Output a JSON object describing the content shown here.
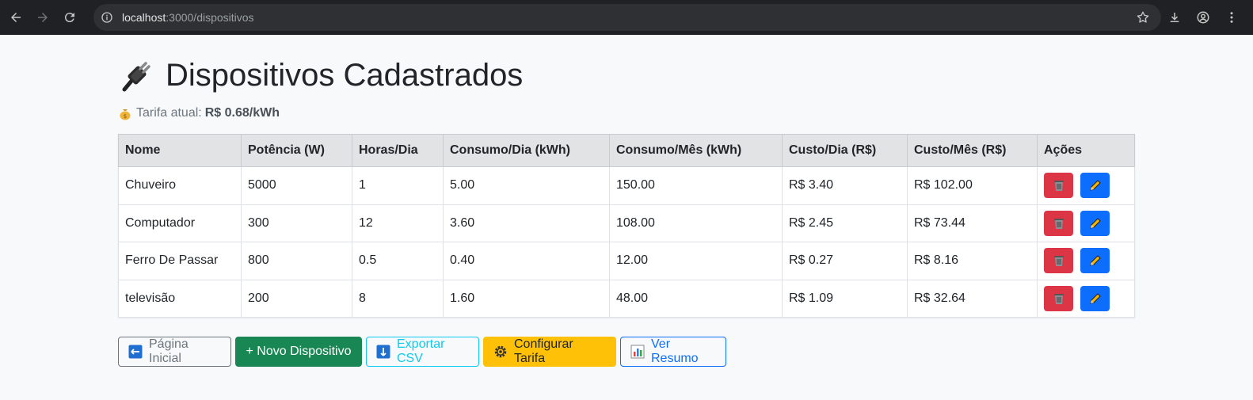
{
  "browser": {
    "url_host": "localhost",
    "url_path": ":3000/dispositivos"
  },
  "page": {
    "title": "Dispositivos Cadastrados",
    "tariff_label": "Tarifa atual:",
    "tariff_value": "R$ 0.68/kWh"
  },
  "table": {
    "headers": [
      "Nome",
      "Potência (W)",
      "Horas/Dia",
      "Consumo/Dia (kWh)",
      "Consumo/Mês (kWh)",
      "Custo/Dia (R$)",
      "Custo/Mês (R$)",
      "Ações"
    ],
    "rows": [
      [
        "Chuveiro",
        "5000",
        "1",
        "5.00",
        "150.00",
        "R$ 3.40",
        "R$ 102.00"
      ],
      [
        "Computador",
        "300",
        "12",
        "3.60",
        "108.00",
        "R$ 2.45",
        "R$ 73.44"
      ],
      [
        "Ferro De Passar",
        "800",
        "0.5",
        "0.40",
        "12.00",
        "R$ 0.27",
        "R$ 8.16"
      ],
      [
        "televisão",
        "200",
        "8",
        "1.60",
        "48.00",
        "R$ 1.09",
        "R$ 32.64"
      ]
    ]
  },
  "buttons": {
    "home": "Página Inicial",
    "new_device": "+ Novo Dispositivo",
    "export_csv": "Exportar CSV",
    "config_tariff": "Configurar Tarifa",
    "summary": "Ver Resumo"
  },
  "colors": {
    "danger": "#dc3545",
    "primary": "#0d6efd",
    "success": "#198754",
    "info": "#0dcaf0",
    "warning": "#ffc107",
    "secondary": "#6c757d"
  }
}
